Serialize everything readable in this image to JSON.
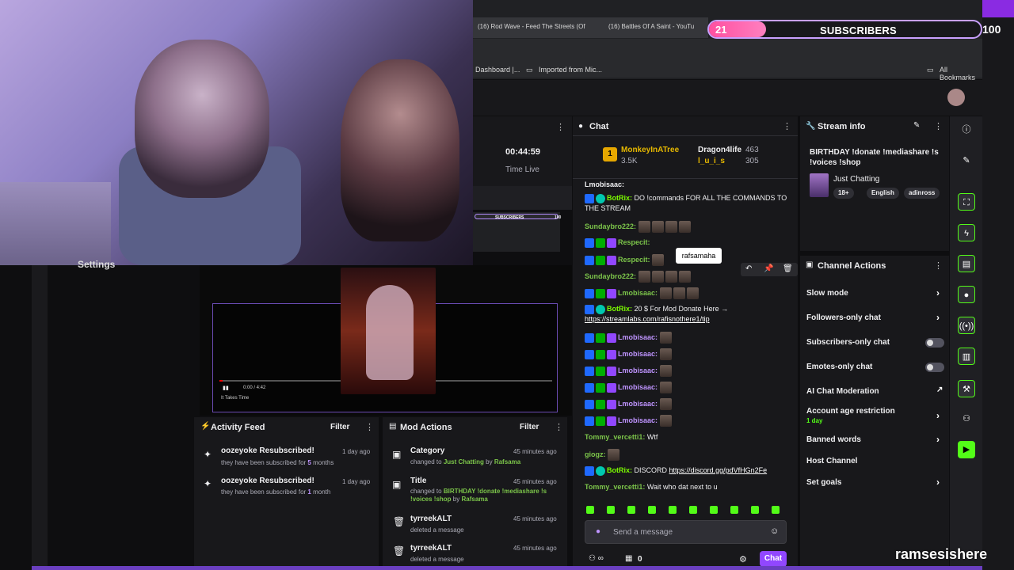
{
  "browser": {
    "tabs": [
      "(16) Rod Wave - Feed The Streets (Of",
      "(16) Battles Of A Saint - YouTu"
    ],
    "bookmarks": [
      "Dashboard |...",
      "Imported from Mic...",
      "All Bookmarks"
    ]
  },
  "subscriber_bar": {
    "count": "21",
    "label": "SUBSCRIBERS",
    "goal": "100",
    "progress_fraction": 0.21
  },
  "settings_label": "Settings",
  "stream_time": {
    "value": "00:44:59",
    "label": "Time Live"
  },
  "mini_overlay": {
    "label": "SUBSCRIBERS",
    "goal": "100"
  },
  "video_player": {
    "time": "0:00 / 4:42",
    "title": "It Takes Time"
  },
  "activity_feed": {
    "title": "Activity Feed",
    "filter": "Filter",
    "items": [
      {
        "title": "oozeyoke Resubscribed!",
        "time": "1 day ago",
        "desc_pre": "they have been subscribed for ",
        "count": "5",
        "desc_post": " months"
      },
      {
        "title": "oozeyoke Resubscribed!",
        "time": "1 day ago",
        "desc_pre": "they have been subscribed for ",
        "count": "1",
        "desc_post": " month"
      }
    ]
  },
  "mod_actions": {
    "title": "Mod Actions",
    "filter": "Filter",
    "items": [
      {
        "title": "Category",
        "time": "45 minutes ago",
        "pre": "changed to ",
        "value": "Just Chatting",
        "by": " by ",
        "user": "Rafsama"
      },
      {
        "title": "Title",
        "time": "45 minutes ago",
        "pre": "changed to ",
        "value": "BIRTHDAY !donate !mediashare !s !voices !shop",
        "by": " by ",
        "user": "Rafsama"
      },
      {
        "title": "tyrreekALT",
        "time": "45 minutes ago",
        "pre": "deleted a message"
      },
      {
        "title": "tyrreekALT",
        "time": "45 minutes ago",
        "pre": "deleted a message"
      }
    ]
  },
  "chat": {
    "title": "Chat",
    "top_gifters": [
      {
        "rank": "1",
        "name": "MonkeyInATree",
        "count": "3.5K"
      },
      {
        "name": "Dragon4life",
        "count": "463"
      },
      {
        "name": "l_u_i_s",
        "count": "305"
      }
    ],
    "messages": [
      {
        "user": "Lmobisaac:",
        "text": ""
      },
      {
        "user": "BotRix:",
        "text": "DO !commands FOR ALL THE COMMANDS TO THE STREAM"
      },
      {
        "user": "Sundaybro222:",
        "text": ""
      },
      {
        "user": "Respecit:",
        "text": ""
      },
      {
        "user": "Respecit:",
        "text": ""
      },
      {
        "user": "Sundaybro222:",
        "text": ""
      },
      {
        "user": "Lmobisaac:",
        "text": ""
      },
      {
        "user": "BotRix:",
        "text": "20 $ For Mod Donate Here →",
        "link": "https://streamlabs.com/rafisnothere1/tip"
      },
      {
        "user": "Lmobisaac:",
        "text": ""
      },
      {
        "user": "Lmobisaac:",
        "text": ""
      },
      {
        "user": "Lmobisaac:",
        "text": ""
      },
      {
        "user": "Lmobisaac:",
        "text": ""
      },
      {
        "user": "Lmobisaac:",
        "text": ""
      },
      {
        "user": "Lmobisaac:",
        "text": ""
      },
      {
        "user": "Tommy_vercetti1:",
        "text": "Wtf"
      },
      {
        "user": "giogz:",
        "text": ""
      },
      {
        "user": "BotRix:",
        "text": "DISCORD",
        "link": "https://discord.gg/pdVfHGn2Fe"
      },
      {
        "user": "Tommy_vercetti1:",
        "text": "Wait who dat next to u"
      }
    ],
    "tooltip": "rafsamaha",
    "input_placeholder": "Send a message",
    "points": "0",
    "chat_button": "Chat"
  },
  "stream_info": {
    "title": "Stream info",
    "stream_title": "BIRTHDAY !donate !mediashare !s !voices !shop",
    "category": "Just Chatting",
    "tags": [
      "18+",
      "English",
      "adinross"
    ]
  },
  "channel_actions": {
    "title": "Channel Actions",
    "items": [
      {
        "label": "Slow mode",
        "kind": "chevron"
      },
      {
        "label": "Followers-only chat",
        "kind": "chevron"
      },
      {
        "label": "Subscribers-only chat",
        "kind": "toggle"
      },
      {
        "label": "Emotes-only chat",
        "kind": "toggle"
      },
      {
        "label": "AI Chat Moderation",
        "kind": "external"
      },
      {
        "label": "Account age restriction",
        "sub": "1 day",
        "kind": "chevron"
      },
      {
        "label": "Banned words",
        "kind": "chevron"
      },
      {
        "label": "Host Channel",
        "kind": "none"
      },
      {
        "label": "Set goals",
        "kind": "chevron"
      }
    ]
  },
  "watermark": "ramsesishere",
  "colors": {
    "accent": "#9147ff",
    "green": "#53fc18",
    "bg": "#18181b"
  }
}
